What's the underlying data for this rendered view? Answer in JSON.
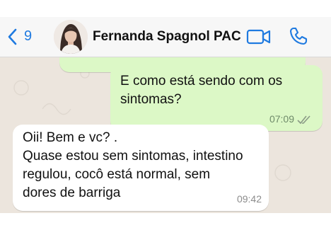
{
  "header": {
    "back_count": "9",
    "contact_name": "Fernanda Spagnol PAC"
  },
  "colors": {
    "accent": "#1f7ae0",
    "outgoing_bubble": "#dcf8c6",
    "incoming_bubble": "#ffffff",
    "chat_background": "#ece5dd"
  },
  "messages": [
    {
      "direction": "outgoing",
      "text": "E como está sendo com os\nsintomas?",
      "time": "07:09",
      "status": "read-double-check"
    },
    {
      "direction": "incoming",
      "text": "Oii! Bem e vc? .\nQuase estou sem sintomas, intestino\nregulou, cocô está normal, sem\ndores de barriga",
      "time": "09:42"
    }
  ],
  "icons": [
    "chevron-left-icon",
    "video-camera-icon",
    "phone-icon",
    "double-check-icon"
  ]
}
